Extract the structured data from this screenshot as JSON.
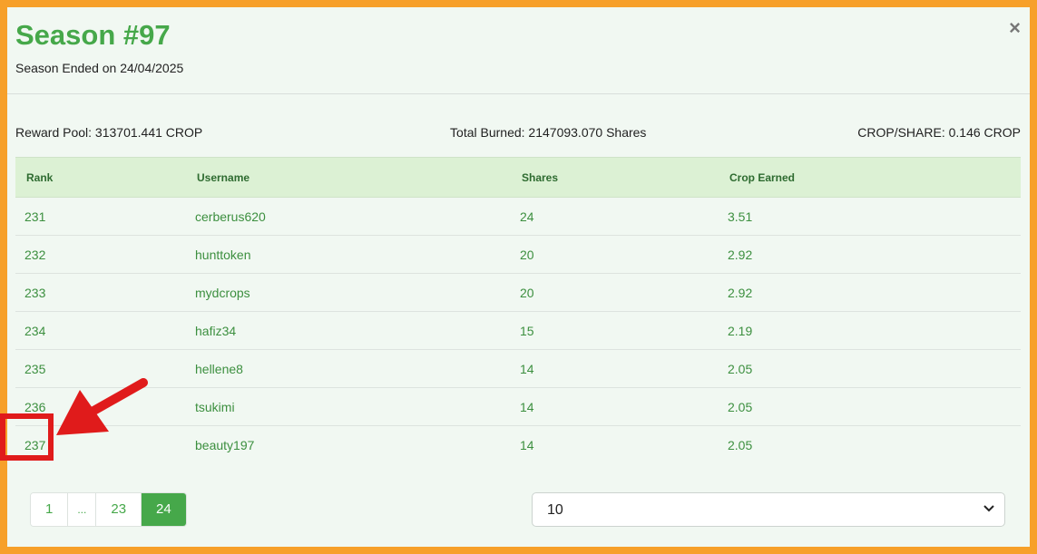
{
  "header": {
    "title": "Season #97",
    "subtitle": "Season Ended on 24/04/2025",
    "close_label": "×"
  },
  "stats": {
    "reward_pool": "Reward Pool: 313701.441 CROP",
    "total_burned": "Total Burned: 2147093.070 Shares",
    "crop_per_share": "CROP/SHARE: 0.146 CROP"
  },
  "table": {
    "headers": [
      "Rank",
      "Username",
      "Shares",
      "Crop Earned"
    ],
    "rows": [
      [
        "231",
        "cerberus620",
        "24",
        "3.51"
      ],
      [
        "232",
        "hunttoken",
        "20",
        "2.92"
      ],
      [
        "233",
        "mydcrops",
        "20",
        "2.92"
      ],
      [
        "234",
        "hafiz34",
        "15",
        "2.19"
      ],
      [
        "235",
        "hellene8",
        "14",
        "2.05"
      ],
      [
        "236",
        "tsukimi",
        "14",
        "2.05"
      ],
      [
        "237",
        "beauty197",
        "14",
        "2.05"
      ]
    ]
  },
  "pagination": {
    "pages": [
      "1",
      "...",
      "23",
      "24"
    ],
    "active": "24"
  },
  "page_size": {
    "selected": "10"
  },
  "annotation": {
    "highlight_color": "#e01b1b"
  },
  "colors": {
    "accent": "#46a84a",
    "background": "#f7a02a"
  }
}
